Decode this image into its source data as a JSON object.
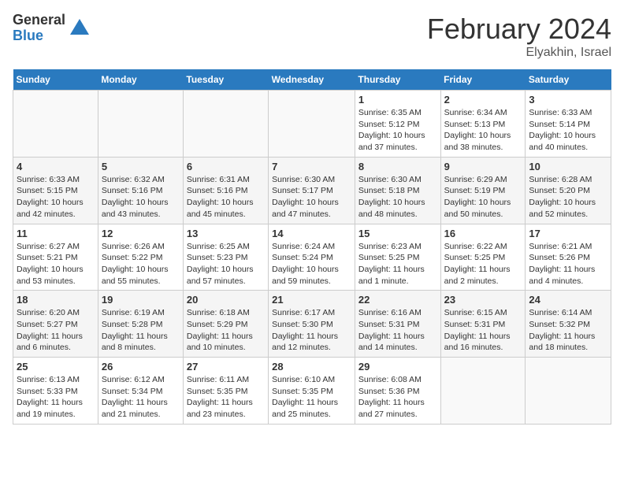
{
  "logo": {
    "general": "General",
    "blue": "Blue"
  },
  "title": {
    "month": "February 2024",
    "location": "Elyakhin, Israel"
  },
  "calendar": {
    "headers": [
      "Sunday",
      "Monday",
      "Tuesday",
      "Wednesday",
      "Thursday",
      "Friday",
      "Saturday"
    ],
    "weeks": [
      [
        {
          "num": "",
          "info": ""
        },
        {
          "num": "",
          "info": ""
        },
        {
          "num": "",
          "info": ""
        },
        {
          "num": "",
          "info": ""
        },
        {
          "num": "1",
          "info": "Sunrise: 6:35 AM\nSunset: 5:12 PM\nDaylight: 10 hours and 37 minutes."
        },
        {
          "num": "2",
          "info": "Sunrise: 6:34 AM\nSunset: 5:13 PM\nDaylight: 10 hours and 38 minutes."
        },
        {
          "num": "3",
          "info": "Sunrise: 6:33 AM\nSunset: 5:14 PM\nDaylight: 10 hours and 40 minutes."
        }
      ],
      [
        {
          "num": "4",
          "info": "Sunrise: 6:33 AM\nSunset: 5:15 PM\nDaylight: 10 hours and 42 minutes."
        },
        {
          "num": "5",
          "info": "Sunrise: 6:32 AM\nSunset: 5:16 PM\nDaylight: 10 hours and 43 minutes."
        },
        {
          "num": "6",
          "info": "Sunrise: 6:31 AM\nSunset: 5:16 PM\nDaylight: 10 hours and 45 minutes."
        },
        {
          "num": "7",
          "info": "Sunrise: 6:30 AM\nSunset: 5:17 PM\nDaylight: 10 hours and 47 minutes."
        },
        {
          "num": "8",
          "info": "Sunrise: 6:30 AM\nSunset: 5:18 PM\nDaylight: 10 hours and 48 minutes."
        },
        {
          "num": "9",
          "info": "Sunrise: 6:29 AM\nSunset: 5:19 PM\nDaylight: 10 hours and 50 minutes."
        },
        {
          "num": "10",
          "info": "Sunrise: 6:28 AM\nSunset: 5:20 PM\nDaylight: 10 hours and 52 minutes."
        }
      ],
      [
        {
          "num": "11",
          "info": "Sunrise: 6:27 AM\nSunset: 5:21 PM\nDaylight: 10 hours and 53 minutes."
        },
        {
          "num": "12",
          "info": "Sunrise: 6:26 AM\nSunset: 5:22 PM\nDaylight: 10 hours and 55 minutes."
        },
        {
          "num": "13",
          "info": "Sunrise: 6:25 AM\nSunset: 5:23 PM\nDaylight: 10 hours and 57 minutes."
        },
        {
          "num": "14",
          "info": "Sunrise: 6:24 AM\nSunset: 5:24 PM\nDaylight: 10 hours and 59 minutes."
        },
        {
          "num": "15",
          "info": "Sunrise: 6:23 AM\nSunset: 5:25 PM\nDaylight: 11 hours and 1 minute."
        },
        {
          "num": "16",
          "info": "Sunrise: 6:22 AM\nSunset: 5:25 PM\nDaylight: 11 hours and 2 minutes."
        },
        {
          "num": "17",
          "info": "Sunrise: 6:21 AM\nSunset: 5:26 PM\nDaylight: 11 hours and 4 minutes."
        }
      ],
      [
        {
          "num": "18",
          "info": "Sunrise: 6:20 AM\nSunset: 5:27 PM\nDaylight: 11 hours and 6 minutes."
        },
        {
          "num": "19",
          "info": "Sunrise: 6:19 AM\nSunset: 5:28 PM\nDaylight: 11 hours and 8 minutes."
        },
        {
          "num": "20",
          "info": "Sunrise: 6:18 AM\nSunset: 5:29 PM\nDaylight: 11 hours and 10 minutes."
        },
        {
          "num": "21",
          "info": "Sunrise: 6:17 AM\nSunset: 5:30 PM\nDaylight: 11 hours and 12 minutes."
        },
        {
          "num": "22",
          "info": "Sunrise: 6:16 AM\nSunset: 5:31 PM\nDaylight: 11 hours and 14 minutes."
        },
        {
          "num": "23",
          "info": "Sunrise: 6:15 AM\nSunset: 5:31 PM\nDaylight: 11 hours and 16 minutes."
        },
        {
          "num": "24",
          "info": "Sunrise: 6:14 AM\nSunset: 5:32 PM\nDaylight: 11 hours and 18 minutes."
        }
      ],
      [
        {
          "num": "25",
          "info": "Sunrise: 6:13 AM\nSunset: 5:33 PM\nDaylight: 11 hours and 19 minutes."
        },
        {
          "num": "26",
          "info": "Sunrise: 6:12 AM\nSunset: 5:34 PM\nDaylight: 11 hours and 21 minutes."
        },
        {
          "num": "27",
          "info": "Sunrise: 6:11 AM\nSunset: 5:35 PM\nDaylight: 11 hours and 23 minutes."
        },
        {
          "num": "28",
          "info": "Sunrise: 6:10 AM\nSunset: 5:35 PM\nDaylight: 11 hours and 25 minutes."
        },
        {
          "num": "29",
          "info": "Sunrise: 6:08 AM\nSunset: 5:36 PM\nDaylight: 11 hours and 27 minutes."
        },
        {
          "num": "",
          "info": ""
        },
        {
          "num": "",
          "info": ""
        }
      ]
    ]
  }
}
